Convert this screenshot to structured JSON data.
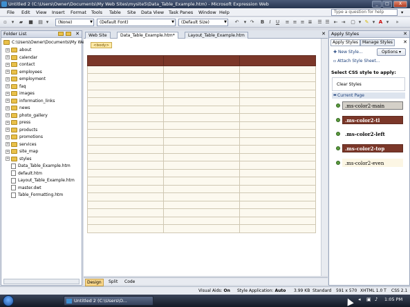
{
  "window": {
    "title": "Untitled 2 (C:\\Users\\Owner\\Documents\\My Web Sites\\mysite5\\Data_Table_Example.htm) - Microsoft Expression Web",
    "controls": [
      "_",
      "□",
      "X"
    ]
  },
  "menubar": {
    "items": [
      "File",
      "Edit",
      "View",
      "Insert",
      "Format",
      "Tools",
      "Table",
      "Site",
      "Data View",
      "Task Panes",
      "Window",
      "Help"
    ],
    "help_placeholder": "Type a question for help"
  },
  "toolbar": {
    "style_select": "(None)",
    "font_select": "(Default Font)",
    "size_select": "(Default Size)"
  },
  "folder_list": {
    "title": "Folder List",
    "root": "C:\\Users\\Owner\\Documents\\My Web",
    "folders": [
      "about",
      "calendar",
      "contact",
      "employees",
      "employment",
      "faq",
      "images",
      "information_links",
      "news",
      "photo_gallery",
      "press",
      "products",
      "promotions",
      "services",
      "site_map",
      "styles"
    ],
    "files": [
      "Data_Table_Example.htm",
      "default.htm",
      "Layout_Table_Example.htm",
      "master.dwt",
      "Table_Formatting.htm"
    ]
  },
  "editor": {
    "tabs": [
      "Web Site",
      "Data_Table_Example.htm*",
      "Layout_Table_Example.htm"
    ],
    "active_tab": 1,
    "body_tag": "<body>",
    "view_tabs": [
      "Design",
      "Split",
      "Code"
    ],
    "active_view": 0
  },
  "apply_styles": {
    "title": "Apply Styles",
    "tabs": [
      "Apply Styles",
      "Manage Styles"
    ],
    "new_style": "New Style...",
    "attach": "Attach Style Sheet...",
    "options": "Options",
    "select_label": "Select CSS style to apply:",
    "clear": "Clear Styles",
    "section": "Current Page",
    "styles": [
      {
        "name": ".ms-color2-main",
        "bg": "#d4d0c8",
        "fg": "#000000",
        "bold": false,
        "border": "#777777"
      },
      {
        "name": ".ms-color2-tl",
        "bg": "#7b3729",
        "fg": "#ffffff",
        "bold": true,
        "border": "#5e2a1f"
      },
      {
        "name": ".ms-color2-left",
        "bg": "#ffffff",
        "fg": "#000000",
        "bold": true,
        "border": "#ffffff"
      },
      {
        "name": ".ms-color2-top",
        "bg": "#7b3729",
        "fg": "#ffffff",
        "bold": true,
        "border": "#5e2a1f"
      },
      {
        "name": ".ms-color2-even",
        "bg": "#fcf6e4",
        "fg": "#000000",
        "bold": false,
        "border": "#fcf6e4"
      }
    ]
  },
  "table": {
    "columns": 3,
    "rows": 22,
    "header_color": "#7b3729",
    "cell_color": "#fcf9ef"
  },
  "statusbar": {
    "visual_aids_label": "Visual Aids:",
    "visual_aids_value": "On",
    "style_app_label": "Style Application:",
    "style_app_value": "Auto",
    "size": "3.99 KB",
    "mode": "Standard",
    "dimensions": "591 x 570",
    "doctype": "XHTML 1.0 T",
    "css": "CSS 2.1"
  },
  "taskbar": {
    "button": "Untitled 2 (C:\\Users\\O...",
    "clock": "1:05 PM"
  }
}
